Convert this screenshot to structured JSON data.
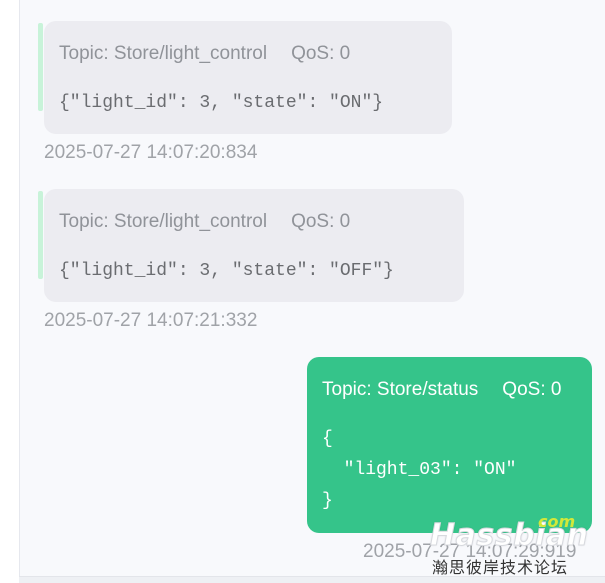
{
  "messages": [
    {
      "direction": "received",
      "topic": "Topic: Store/light_control",
      "qos": "QoS: 0",
      "payload": "{\"light_id\": 3, \"state\": \"ON\"}",
      "timestamp": "2025-07-27 14:07:20:834"
    },
    {
      "direction": "received",
      "topic": "Topic: Store/light_control",
      "qos": "QoS: 0",
      "payload": "{\"light_id\": 3, \"state\": \"OFF\"}",
      "timestamp": "2025-07-27 14:07:21:332"
    },
    {
      "direction": "sent",
      "topic": "Topic: Store/status",
      "qos": "QoS: 0",
      "payload": "{\n  \"light_03\": \"ON\"\n}",
      "timestamp": "2025-07-27 14:07:29:919"
    }
  ],
  "watermark": {
    "brand": "Hassbian",
    "domain": "com",
    "subtitle": "瀚思彼岸技术论坛"
  },
  "colors": {
    "received_bubble": "#ececf1",
    "sent_bubble": "#35c48a",
    "received_accent": "#c8f3d9",
    "timestamp": "#a0a3a8"
  }
}
